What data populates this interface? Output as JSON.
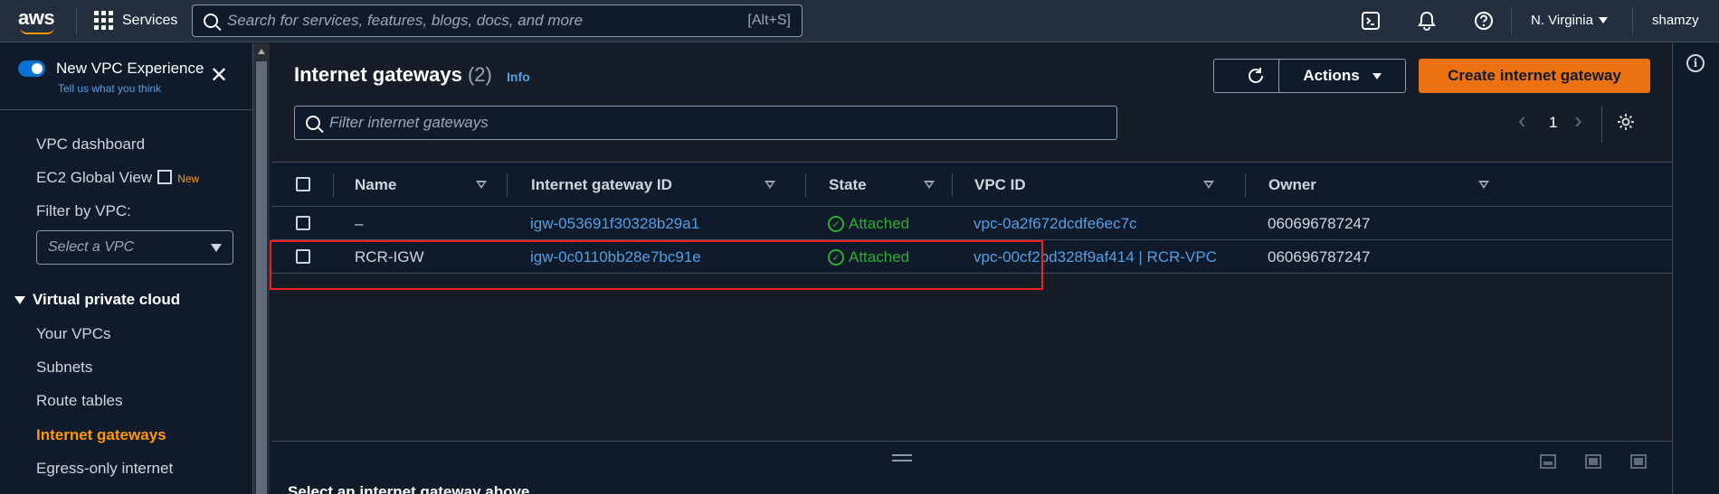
{
  "topnav": {
    "logo": "aws",
    "services_label": "Services",
    "search_placeholder": "Search for services, features, blogs, docs, and more",
    "search_shortcut": "[Alt+S]",
    "icons": [
      "cloudshell-icon",
      "bell-icon",
      "help-icon"
    ],
    "region": "N. Virginia",
    "user": "shamzy"
  },
  "sidebar": {
    "toggle_label": "New VPC Experience",
    "toggle_on": true,
    "tell_link": "Tell us what you think",
    "items_top": [
      "VPC dashboard",
      "EC2 Global View",
      "Filter by VPC:"
    ],
    "new_badge": "New",
    "vpc_select_placeholder": "Select a VPC",
    "section": "Virtual private cloud",
    "items": [
      "Your VPCs",
      "Subnets",
      "Route tables",
      "Internet gateways",
      "Egress-only internet"
    ],
    "active": "Internet gateways"
  },
  "main": {
    "title": "Internet gateways",
    "count": "(2)",
    "info": "Info",
    "actions_label": "Actions",
    "create_label": "Create internet gateway",
    "filter_placeholder": "Filter internet gateways",
    "page_number": "1",
    "columns": [
      "Name",
      "Internet gateway ID",
      "State",
      "VPC ID",
      "Owner"
    ],
    "rows": [
      {
        "name": "–",
        "igw_id": "igw-053691f30328b29a1",
        "state": "Attached",
        "vpc_id": "vpc-0a2f672dcdfe6ec7c",
        "owner": "060696787247"
      },
      {
        "name": "RCR-IGW",
        "igw_id": "igw-0c0110bb28e7bc91e",
        "state": "Attached",
        "vpc_id": "vpc-00cf2bd328f9af414 | RCR-VPC",
        "owner": "060696787247"
      }
    ],
    "split_title": "Select an internet gateway above"
  },
  "colors": {
    "nav_bg": "#232f3e",
    "primary": "#ec7211",
    "link": "#539fe5",
    "success": "#29ad32",
    "active_nav": "#ff9900",
    "highlight": "#ee2222"
  }
}
